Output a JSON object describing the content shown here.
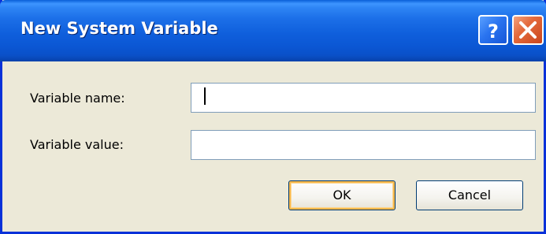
{
  "window": {
    "title": "New System Variable"
  },
  "titlebar_buttons": {
    "help": "?",
    "close": "X"
  },
  "form": {
    "name_label": "Variable name:",
    "name_value": "",
    "value_label": "Variable value:",
    "value_value": ""
  },
  "buttons": {
    "ok": "OK",
    "cancel": "Cancel"
  },
  "colors": {
    "titlebar": "#0a5fd8",
    "dialog_bg": "#ece9d8",
    "close_button": "#e46a3c",
    "help_button": "#2a74f0"
  },
  "icons": [
    "help-icon",
    "close-icon"
  ]
}
